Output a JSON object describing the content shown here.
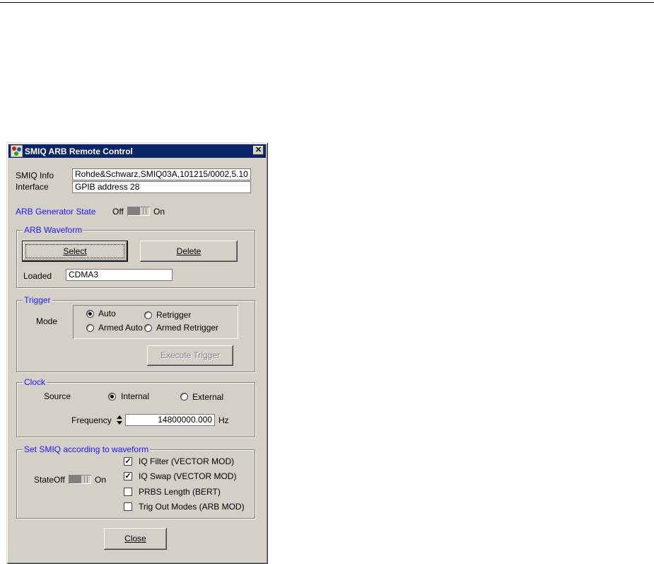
{
  "window": {
    "title": "SMIQ ARB Remote Control",
    "close_glyph": "✕",
    "icon": "app-icon"
  },
  "info": {
    "smiq_info_label": "SMIQ Info",
    "smiq_info_value": "Rohde&Schwarz,SMIQ03A,101215/0002,5.10",
    "interface_label": "Interface",
    "interface_value": "GPIB address 28"
  },
  "arb_state": {
    "label": "ARB Generator State",
    "off_label": "Off",
    "on_label": "On",
    "value": "Off"
  },
  "arb_waveform": {
    "legend": "ARB Waveform",
    "select_label": "Select",
    "delete_label": "Delete",
    "loaded_label": "Loaded",
    "loaded_value": "CDMA3"
  },
  "trigger": {
    "legend": "Trigger",
    "mode_label": "Mode",
    "options": [
      "Auto",
      "Retrigger",
      "Armed Auto",
      "Armed Retrigger"
    ],
    "selected": "Auto",
    "execute_label": "Execute Trigger"
  },
  "clock": {
    "legend": "Clock",
    "source_label": "Source",
    "internal_label": "Internal",
    "external_label": "External",
    "selected": "Internal",
    "frequency_label": "Frequency",
    "frequency_value": "14800000.000",
    "frequency_unit": "Hz"
  },
  "set_smiq": {
    "legend": "Set SMIQ according to waveform",
    "state_label": "State",
    "off_label": "Off",
    "on_label": "On",
    "checks": [
      {
        "label": "IQ Filter (VECTOR MOD)",
        "checked": true
      },
      {
        "label": "IQ Swap (VECTOR MOD)",
        "checked": true
      },
      {
        "label": "PRBS Length (BERT)",
        "checked": false
      },
      {
        "label": "Trig Out Modes (ARB MOD)",
        "checked": false
      }
    ],
    "check_mark": "✓"
  },
  "footer": {
    "close_label": "Close"
  }
}
